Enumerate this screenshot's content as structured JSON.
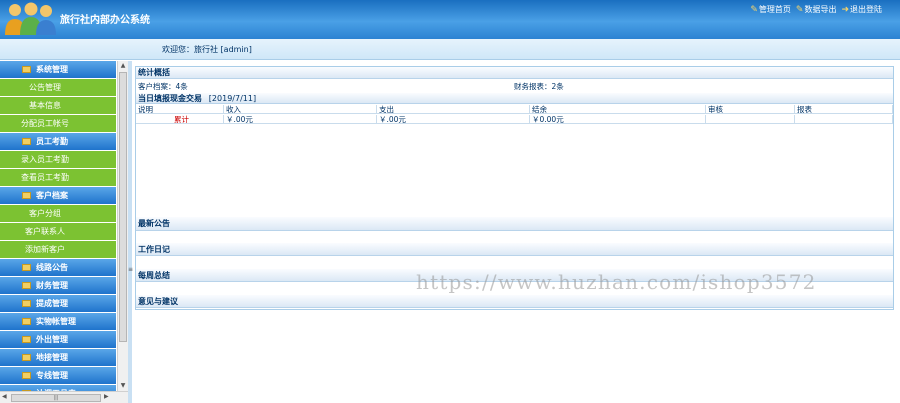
{
  "header": {
    "title": "旅行社内部办公系统",
    "links": [
      {
        "label": "管理首页",
        "icon": "key-icon"
      },
      {
        "label": "数据导出",
        "icon": "key-icon"
      },
      {
        "label": "退出登陆",
        "icon": "arrow-exit-icon"
      }
    ]
  },
  "welcome": {
    "text": "欢迎您：旅行社 [admin]"
  },
  "sidebar": {
    "items": [
      {
        "label": "系统管理",
        "type": "section"
      },
      {
        "label": "公告管理",
        "type": "sub"
      },
      {
        "label": "基本信息",
        "type": "sub"
      },
      {
        "label": "分配员工帐号",
        "type": "sub"
      },
      {
        "label": "员工考勤",
        "type": "section"
      },
      {
        "label": "录入员工考勤",
        "type": "sub"
      },
      {
        "label": "查看员工考勤",
        "type": "sub"
      },
      {
        "label": "客户档案",
        "type": "section"
      },
      {
        "label": "客户分组",
        "type": "sub"
      },
      {
        "label": "客户联系人",
        "type": "sub"
      },
      {
        "label": "添加新客户",
        "type": "sub"
      },
      {
        "label": "线路公告",
        "type": "section"
      },
      {
        "label": "财务管理",
        "type": "section"
      },
      {
        "label": "提成管理",
        "type": "section"
      },
      {
        "label": "实物帐管理",
        "type": "section"
      },
      {
        "label": "外出管理",
        "type": "section"
      },
      {
        "label": "地接管理",
        "type": "section"
      },
      {
        "label": "专线管理",
        "type": "section"
      },
      {
        "label": "计调工具表",
        "type": "section"
      }
    ]
  },
  "main": {
    "stats_title": "统计概括",
    "customer_count": "客户档案：4条",
    "finance_count": "财务报表：2条",
    "trade_title": "当日填报现金交易",
    "trade_date": "[2019/7/11]",
    "trade_headers": [
      "说明",
      "收入",
      "支出",
      "结余",
      "审核",
      "报表"
    ],
    "trade_rows": [
      {
        "desc": "累计",
        "income": "￥.00元",
        "expense": "￥.00元",
        "balance": "￥0.00元",
        "audit": "",
        "report": ""
      }
    ],
    "sections": [
      {
        "title": "最新公告"
      },
      {
        "title": "工作日记"
      },
      {
        "title": "每周总结"
      },
      {
        "title": "意见与建议"
      }
    ]
  },
  "watermark": "https://www.huzhan.com/ishop3572",
  "colors": {
    "header": "#2b82d2",
    "nav_section": "#1f73cc",
    "nav_sub": "#7cc232",
    "total_red": "#cc0000"
  }
}
